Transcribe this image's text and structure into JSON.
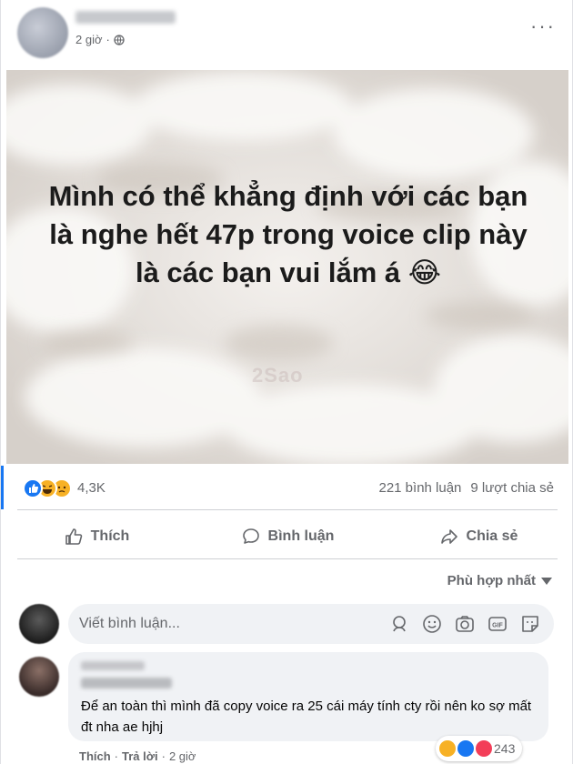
{
  "post": {
    "time": "2 giờ",
    "more_label": "···",
    "image_caption": "Mình có thể khẳng định với các bạn là nghe hết 47p trong voice clip này là các bạn vui lắm á 😂",
    "reaction_count": "4,3K",
    "comments_count": "221 bình luận",
    "shares_count": "9 lượt chia sẻ"
  },
  "actions": {
    "like": "Thích",
    "comment": "Bình luận",
    "share": "Chia sẻ"
  },
  "comments": {
    "sort_label": "Phù hợp nhất",
    "input_placeholder": "Viết bình luận...",
    "items": [
      {
        "text": "Để an toàn thì mình đã copy voice ra 25 cái máy tính cty rồi nên ko sợ mất đt nha ae hjhj",
        "reaction_count": "243",
        "like_label": "Thích",
        "reply_label": "Trả lời",
        "time": "2 giờ"
      }
    ]
  },
  "icons": {
    "globe": "globe-icon",
    "like": "thumbs-up-icon",
    "comment": "speech-bubble-icon",
    "share": "share-arrow-icon",
    "sort": "caret-down-icon",
    "emoji": "smiley-icon",
    "camera": "camera-icon",
    "gif": "gif-icon",
    "sticker": "sticker-icon"
  },
  "colors": {
    "accent": "#1877f2",
    "haha": "#f7b125",
    "love": "#f33e58",
    "muted_text": "#65676b",
    "comment_bg": "#f0f2f5"
  }
}
